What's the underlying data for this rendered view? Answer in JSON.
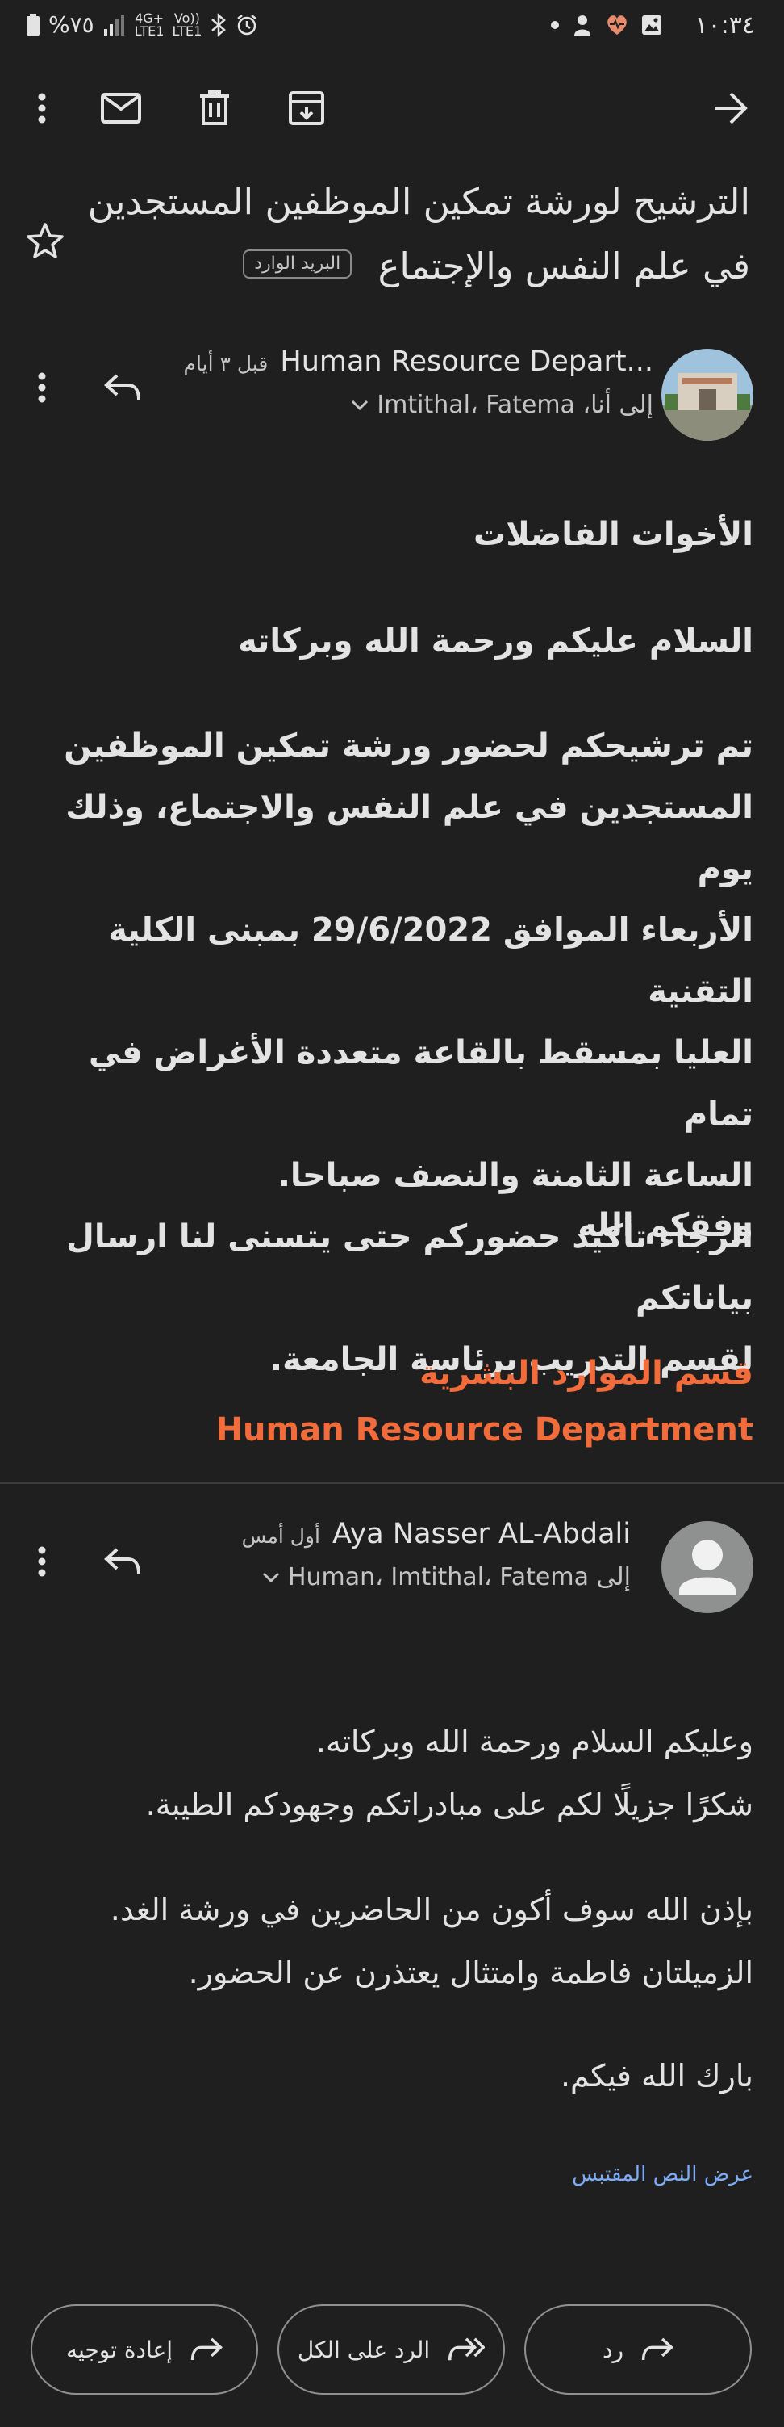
{
  "status_bar": {
    "time": "١٠:٣٤",
    "battery": "%٧٥",
    "net_top": "4G+",
    "net_bottom": "LTE1",
    "volte_top": "Vo))",
    "volte_bottom": "LTE1"
  },
  "toolbar": {
    "icons": [
      "more-vert-icon",
      "mark-unread-icon",
      "delete-icon",
      "archive-icon",
      "forward-arrow-icon"
    ]
  },
  "email": {
    "subject_line1": "الترشيح لورشة تمكين الموظفين المستجدين",
    "subject_line2": "في علم النفس والإجتماع",
    "label": "البريد الوارد"
  },
  "message1": {
    "sender": "Human Resource Depart...",
    "time": "قبل ٣ أيام",
    "recipients": "إلى أنا، Imtithal، Fatema",
    "greeting": "الأخوات الفاضلات",
    "salam": "السلام عليكم ورحمة الله وبركاته",
    "lines": [
      "تم ترشيحكم لحضور ورشة تمكين الموظفين",
      "المستجدين في علم النفس والاجتماع، وذلك يوم",
      "الأربعاء الموافق 29/6/2022 بمبنى الكلية التقنية",
      "العليا بمسقط بالقاعة متعددة الأغراض في تمام",
      "الساعة الثامنة والنصف صباحا.",
      "الرجاء تأكيد حضوركم حتى يتسنى لنا ارسال بياناتكم",
      "لقسم التدريب برئاسة الجامعة."
    ],
    "closing": "وفقكم الله",
    "signature_ar": "قسم الموارد البشرية",
    "signature_en": "Human Resource Department"
  },
  "message2": {
    "sender": "Aya Nasser AL-Abdali",
    "time": "أول أمس",
    "recipients": "إلى Human، Imtithal، Fatema",
    "para1": [
      "وعليكم السلام ورحمة الله وبركاته.",
      "شكرًا جزيلًا لكم على مبادراتكم وجهودكم الطيبة."
    ],
    "para2": [
      "بإذن الله سوف أكون من الحاضرين في ورشة الغد.",
      "الزميلتان فاطمة وامتثال يعتذرن عن الحضور."
    ],
    "closing": "بارك الله فيكم.",
    "show_quoted": "عرض النص المقتبس"
  },
  "actions": {
    "reply": "رد",
    "reply_all": "الرد على الكل",
    "forward": "إعادة توجيه"
  }
}
